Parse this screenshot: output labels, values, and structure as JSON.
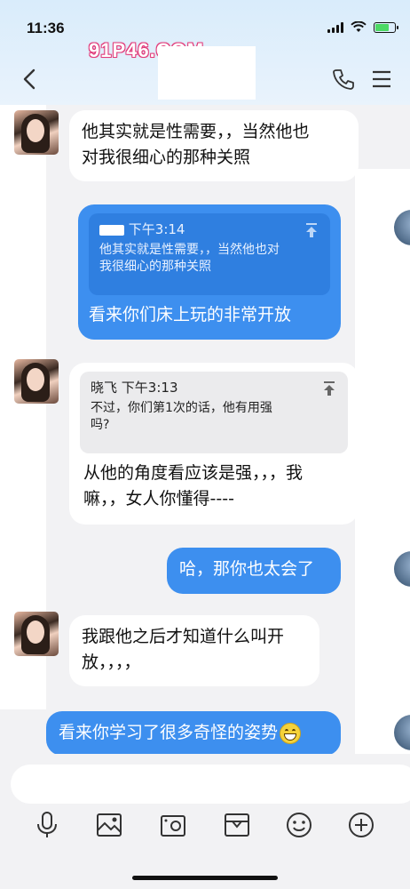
{
  "status_bar": {
    "time": "11:36"
  },
  "watermark": {
    "top_text": "91P46.COM"
  },
  "nav": {
    "back_icon": "chevron-left-icon",
    "phone_icon": "phone-icon",
    "menu_icon": "menu-icon"
  },
  "messages": [
    {
      "direction": "in",
      "text_lines": [
        "他其实就是性需要，，当然他也",
        "对我很细心的那种关照"
      ]
    },
    {
      "direction": "out",
      "quote": {
        "time": "下午3:14",
        "lines": [
          "他其实就是性需要，，当然他也对",
          "我很细心的那种关照"
        ]
      },
      "text": "看来你们床上玩的非常开放"
    },
    {
      "direction": "in",
      "quote": {
        "sender": "晓飞",
        "time": "下午3:13",
        "lines": [
          "不过，你们第1次的话，他有用强",
          "吗?"
        ]
      },
      "text_lines": [
        "从他的角度看应该是强，，，我",
        "嘛，，女人你懂得----"
      ]
    },
    {
      "direction": "out",
      "text": "哈，那你也太会了"
    },
    {
      "direction": "in",
      "text_lines": [
        "我跟他之后才知道什么叫开",
        "放，，，，"
      ]
    },
    {
      "direction": "out",
      "text": "看来你学习了很多奇怪的姿势",
      "emoji": "grinning-face"
    }
  ],
  "toolbar": {
    "icons": [
      "microphone-icon",
      "image-icon",
      "camera-icon",
      "gift-icon",
      "emoji-icon",
      "plus-icon"
    ]
  },
  "colors": {
    "bubble_out": "#3d8fef",
    "bubble_in": "#ffffff",
    "background": "#f2f2f4",
    "watermark": "#e13b7a"
  }
}
